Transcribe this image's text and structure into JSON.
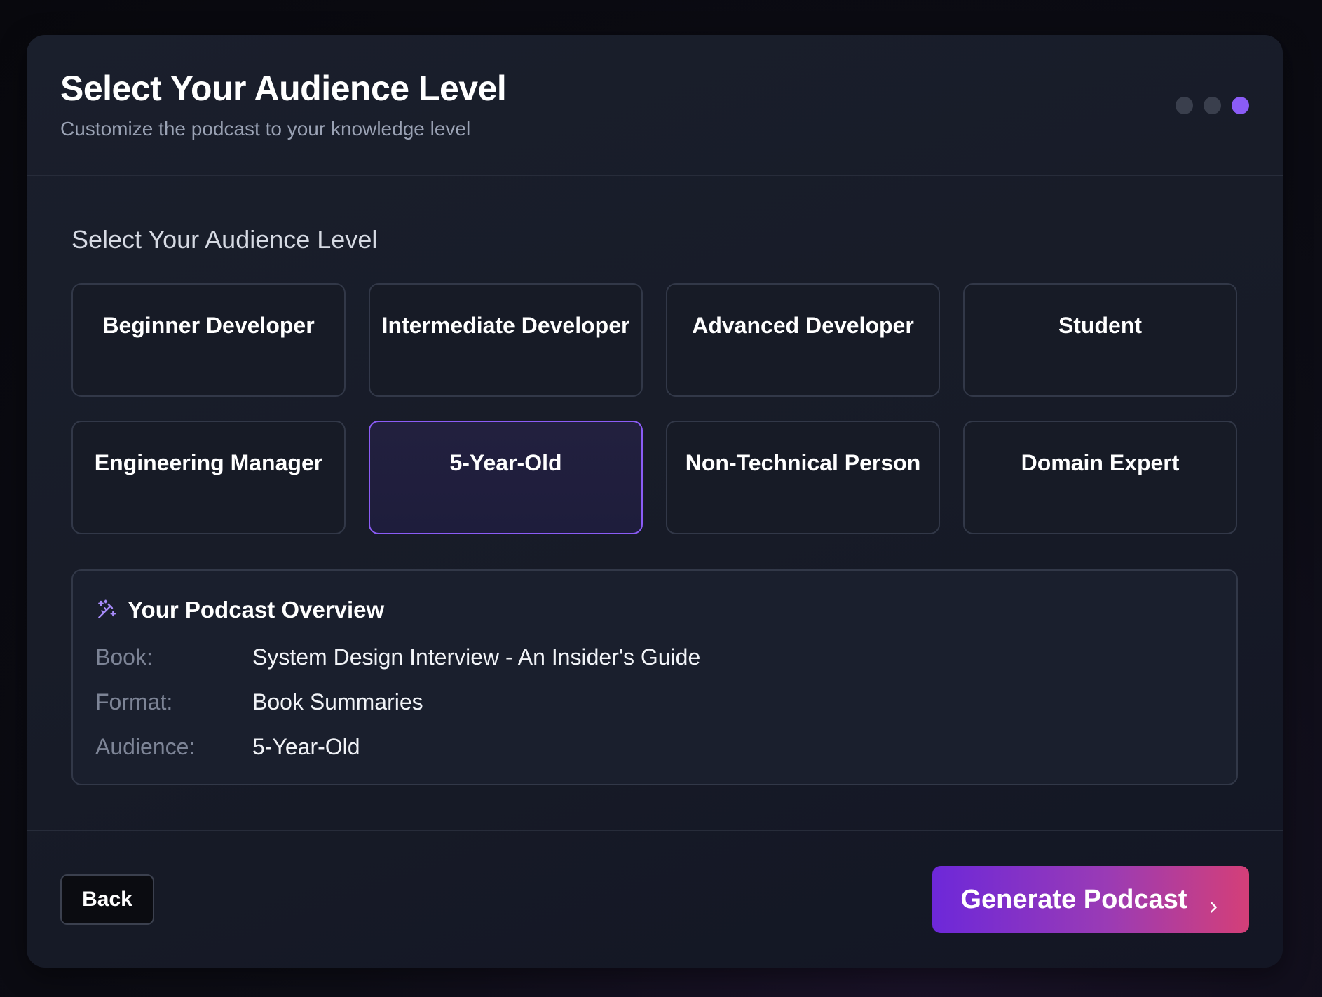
{
  "header": {
    "title": "Select Your Audience Level",
    "subtitle": "Customize the podcast to your knowledge level",
    "steps": {
      "total": 3,
      "current": 3
    }
  },
  "section": {
    "title": "Select Your Audience Level"
  },
  "options": [
    {
      "label": "Beginner Developer",
      "selected": false
    },
    {
      "label": "Intermediate Developer",
      "selected": false
    },
    {
      "label": "Advanced Developer",
      "selected": false
    },
    {
      "label": "Student",
      "selected": false
    },
    {
      "label": "Engineering Manager",
      "selected": false
    },
    {
      "label": "5-Year-Old",
      "selected": true
    },
    {
      "label": "Non-Technical Person",
      "selected": false
    },
    {
      "label": "Domain Expert",
      "selected": false
    }
  ],
  "overview": {
    "title": "Your Podcast Overview",
    "icon": "magic-wand-icon",
    "rows": [
      {
        "label": "Book:",
        "value": "System Design Interview - An Insider's Guide"
      },
      {
        "label": "Format:",
        "value": "Book Summaries"
      },
      {
        "label": "Audience:",
        "value": "5-Year-Old"
      }
    ]
  },
  "footer": {
    "back_label": "Back",
    "generate_label": "Generate Podcast",
    "generate_icon": "chevron-right-icon"
  },
  "colors": {
    "accent": "#8b5cf6",
    "gradient_start": "#6d28d9",
    "gradient_end": "#d43f78"
  }
}
